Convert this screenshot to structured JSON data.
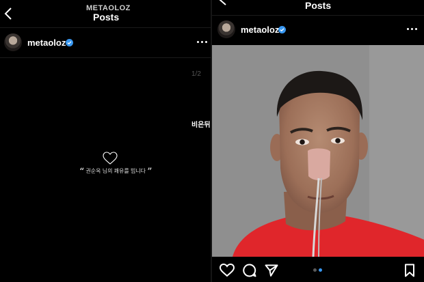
{
  "left": {
    "header": {
      "handle": "METAOLOZ",
      "title": "Posts"
    },
    "post": {
      "username": "metaoloz",
      "counter": "1/2",
      "side_label": "비은뒤",
      "quote_open": "“",
      "quote_text": "권순옥 님의 쾌유를 빕니다",
      "quote_close": "”"
    }
  },
  "right": {
    "header": {
      "title": "Posts"
    },
    "post": {
      "username": "metaoloz"
    },
    "carousel": {
      "count": 2,
      "active": 2
    }
  },
  "colors": {
    "background": "#000000",
    "verified": "#3897f0",
    "shirt": "#e0262b",
    "wall": "#8f8f8f"
  }
}
